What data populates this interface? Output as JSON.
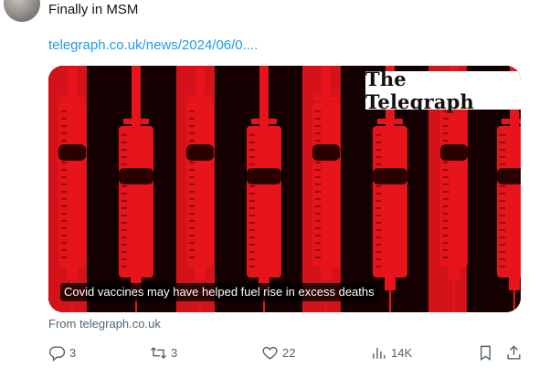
{
  "tweet": {
    "text": "Finally in MSM",
    "link": "telegraph.co.uk/news/2024/06/0...."
  },
  "card": {
    "logo_text": "The Telegraph",
    "caption": "Covid vaccines may have helped fuel rise in excess deaths",
    "source": "From telegraph.co.uk"
  },
  "actions": {
    "replies": "3",
    "retweets": "3",
    "likes": "22",
    "views": "14K"
  },
  "colors": {
    "link": "#1d9bf0",
    "muted": "#536471",
    "image_red": "#e8141c"
  },
  "icons": [
    "reply-icon",
    "retweet-icon",
    "like-icon",
    "views-icon",
    "bookmark-icon",
    "share-icon"
  ]
}
